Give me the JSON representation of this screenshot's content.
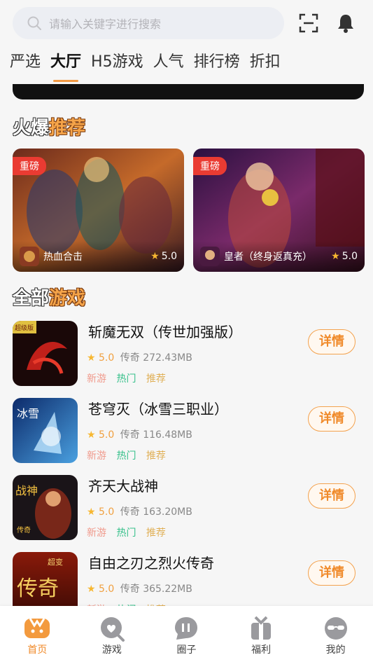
{
  "search": {
    "placeholder": "请输入关键字进行搜索"
  },
  "tabs": [
    "严选",
    "大厅",
    "H5游戏",
    "人气",
    "排行榜",
    "折扣"
  ],
  "active_tab": 1,
  "sections": {
    "hot": {
      "a": "火爆",
      "b": "推荐"
    },
    "all": {
      "a": "全部",
      "b": "游戏"
    }
  },
  "recommend": [
    {
      "tag": "重磅",
      "name": "热血合击",
      "score": "5.0"
    },
    {
      "tag": "重磅",
      "name": "皇者（终身返真充）",
      "score": "5.0"
    }
  ],
  "games": [
    {
      "title": "斩魔无双（传世加强版）",
      "score": "5.0",
      "genre": "传奇",
      "size": "272.43MB",
      "labels": [
        "新游",
        "热门",
        "推荐"
      ],
      "button": "详情"
    },
    {
      "title": "苍穹灭（冰雪三职业）",
      "score": "5.0",
      "genre": "传奇",
      "size": "116.48MB",
      "labels": [
        "新游",
        "热门",
        "推荐"
      ],
      "button": "详情"
    },
    {
      "title": "齐天大战神",
      "score": "5.0",
      "genre": "传奇",
      "size": "163.20MB",
      "labels": [
        "新游",
        "热门",
        "推荐"
      ],
      "button": "详情"
    },
    {
      "title": "自由之刃之烈火传奇",
      "score": "5.0",
      "genre": "传奇",
      "size": "365.22MB",
      "labels": [
        "新游",
        "热门",
        "推荐"
      ],
      "button": "详情"
    }
  ],
  "cover_text": {
    "g1": "超级版",
    "g2": "冰雪",
    "g3a": "战神",
    "g3b": "传奇",
    "g4": "传奇",
    "g4b": "超变"
  },
  "nav": [
    {
      "label": "首页",
      "icon": "home-game-icon"
    },
    {
      "label": "游戏",
      "icon": "game-search-icon"
    },
    {
      "label": "圈子",
      "icon": "circle-chat-icon"
    },
    {
      "label": "福利",
      "icon": "gift-icon"
    },
    {
      "label": "我的",
      "icon": "profile-icon"
    }
  ],
  "colors": {
    "accent": "#f08a2a",
    "tag": "#ea3b32",
    "star": "#f7b731"
  }
}
